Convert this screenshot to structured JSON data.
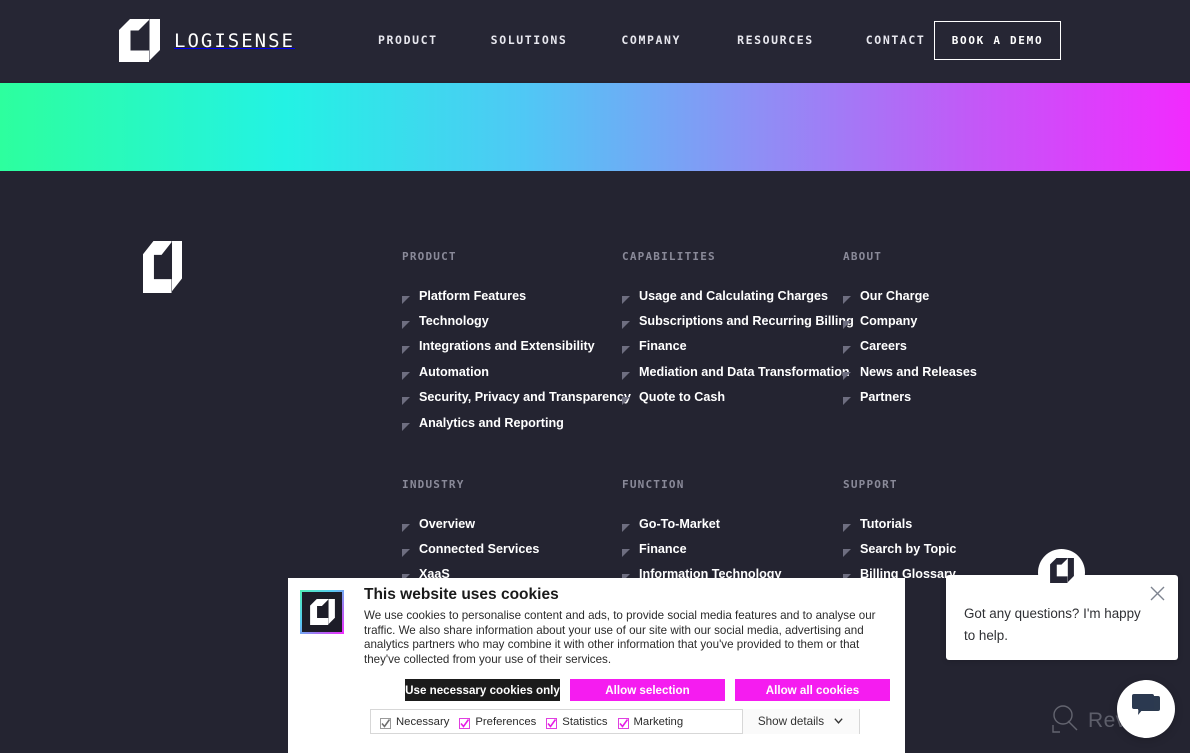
{
  "colors": {
    "page_bg": "#242431",
    "header_bg": "#262634",
    "gradient_start": "#2dff9e",
    "gradient_mid": "#4fc8f5",
    "gradient_end": "#f22aff",
    "accent_magenta": "#f51cf0",
    "link_text": "#ffffff",
    "column_title": "#8a8a99"
  },
  "header": {
    "brand_name": "LOGISENSE",
    "logo_icon": "logisense-l-logo-icon",
    "nav": [
      {
        "label": "PRODUCT"
      },
      {
        "label": "SOLUTIONS"
      },
      {
        "label": "COMPANY"
      },
      {
        "label": "RESOURCES"
      },
      {
        "label": "CONTACT"
      }
    ],
    "demo_button": "BOOK A DEMO"
  },
  "footer": {
    "logo_icon": "logisense-l-logo-icon",
    "columns": [
      {
        "title": "PRODUCT",
        "links": [
          "Platform Features",
          "Technology",
          "Integrations and Extensibility",
          "Automation",
          "Security, Privacy and Transparency",
          "Analytics and Reporting"
        ]
      },
      {
        "title": "CAPABILITIES",
        "links": [
          "Usage and Calculating Charges",
          "Subscriptions and Recurring Billing",
          "Finance",
          "Mediation and Data Transformation",
          "Quote to Cash"
        ]
      },
      {
        "title": "ABOUT",
        "links": [
          "Our Charge",
          "Company",
          "Careers",
          "News and Releases",
          "Partners"
        ]
      },
      {
        "title": "INDUSTRY",
        "links": [
          "Overview",
          "Connected Services",
          "XaaS"
        ]
      },
      {
        "title": "FUNCTION",
        "links": [
          "Go-To-Market",
          "Finance",
          "Information Technology"
        ]
      },
      {
        "title": "SUPPORT",
        "links": [
          "Tutorials",
          "Search by Topic",
          "Billing Glossary"
        ]
      }
    ]
  },
  "cookie_banner": {
    "icon": "logisense-l-logo-icon",
    "title": "This website uses cookies",
    "body": "We use cookies to personalise content and ads, to provide social media features and to analyse our traffic. We also share information about your use of our site with our social media, advertising and analytics partners who may combine it with other information that you've provided to them or that they've collected from your use of their services.",
    "buttons": {
      "necessary": "Use necessary cookies only",
      "selection": "Allow selection",
      "all": "Allow all cookies"
    },
    "preferences": [
      {
        "label": "Necessary",
        "checked": true,
        "disabled": true
      },
      {
        "label": "Preferences",
        "checked": true,
        "disabled": false
      },
      {
        "label": "Statistics",
        "checked": true,
        "disabled": false
      },
      {
        "label": "Marketing",
        "checked": true,
        "disabled": false
      }
    ],
    "show_details": "Show details",
    "show_details_icon": "chevron-down-icon"
  },
  "chat": {
    "avatar_icon": "logisense-l-logo-icon",
    "message": "Got any questions? I'm happy to help.",
    "close_icon": "close-icon",
    "launcher_icon": "chat-bubble-icon"
  },
  "watermark": {
    "text": "Revain",
    "icon": "revain-magnifier-icon"
  }
}
